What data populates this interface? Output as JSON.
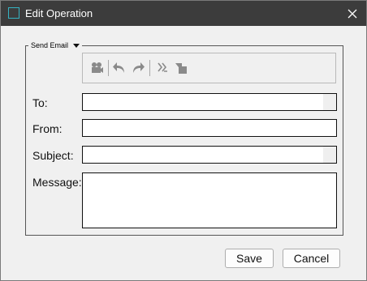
{
  "window": {
    "title": "Edit Operation"
  },
  "group": {
    "title": "Send Email"
  },
  "toolbar": {
    "icons": [
      "camera-icon",
      "undo-icon",
      "redo-icon",
      "fx-icon",
      "paste-icon"
    ]
  },
  "fields": {
    "to": {
      "label": "To:",
      "value": ""
    },
    "from": {
      "label": "From:",
      "value": ""
    },
    "subject": {
      "label": "Subject:",
      "value": ""
    },
    "message": {
      "label": "Message:",
      "value": ""
    }
  },
  "buttons": {
    "save": "Save",
    "cancel": "Cancel"
  },
  "colors": {
    "titlebar": "#3c3c3c",
    "title_icon": "#35b3c2",
    "toolbar_icon": "#8a8a8a"
  }
}
